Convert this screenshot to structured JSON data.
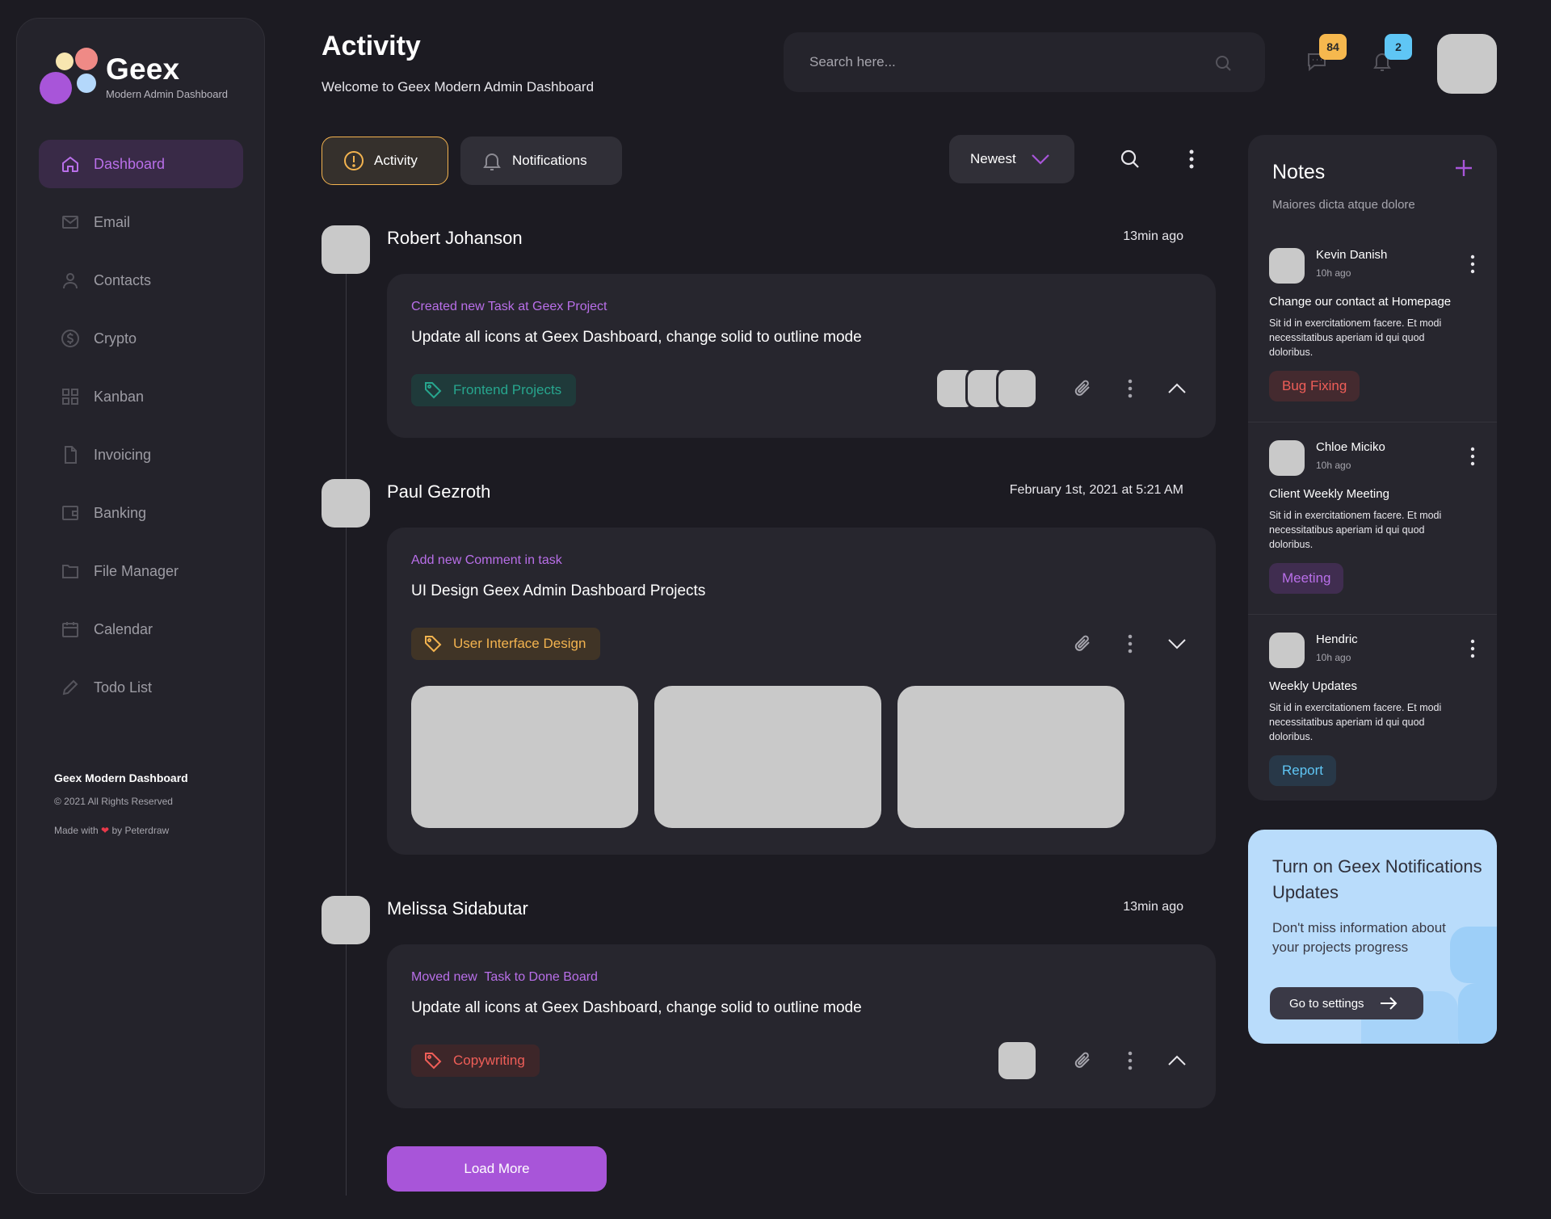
{
  "app": {
    "name": "Geex",
    "tagline": "Modern Admin Dashboard",
    "colors": {
      "accent": "#a855d9",
      "activity_border": "#f3b34f",
      "background": "#1c1b22",
      "panel": "#27262e"
    }
  },
  "header": {
    "title": "Activity",
    "subtitle": "Welcome to Geex Modern Admin Dashboard",
    "search_placeholder": "Search here...",
    "messages_badge": "84",
    "notifications_badge": "2"
  },
  "sidebar": {
    "items": [
      {
        "label": "Dashboard",
        "icon": "home-icon",
        "active": true
      },
      {
        "label": "Email",
        "icon": "mail-icon"
      },
      {
        "label": "Contacts",
        "icon": "user-icon"
      },
      {
        "label": "Crypto",
        "icon": "dollar-coin-icon"
      },
      {
        "label": "Kanban",
        "icon": "grid-icon"
      },
      {
        "label": "Invoicing",
        "icon": "document-icon"
      },
      {
        "label": "Banking",
        "icon": "wallet-icon"
      },
      {
        "label": "File Manager",
        "icon": "folder-icon"
      },
      {
        "label": "Calendar",
        "icon": "calendar-icon"
      },
      {
        "label": "Todo List",
        "icon": "pencil-icon"
      }
    ],
    "footer": {
      "title": "Geex Modern Dashboard",
      "copyright": "© 2021 All Rights Reserved",
      "made_with_prefix": "Made with",
      "made_with_suffix": "by Peterdraw"
    }
  },
  "toolbar": {
    "tab_activity": "Activity",
    "tab_notifications": "Notifications",
    "sort_value": "Newest"
  },
  "activities": [
    {
      "name": "Robert Johanson",
      "time": "13min ago",
      "kicker": "Created new Task at Geex Project",
      "title": "Update all icons at Geex Dashboard, change solid to outline mode",
      "tag": "Frontend Projects"
    },
    {
      "name": "Paul Gezroth",
      "time": "February 1st, 2021 at 5:21 AM",
      "kicker": "Add new Comment in task",
      "title": "UI Design Geex Admin Dashboard Projects",
      "tag": "User Interface Design"
    },
    {
      "name": "Melissa Sidabutar",
      "time": "13min ago",
      "kicker": "Moved new  Task to Done Board",
      "title": "Update all icons at Geex Dashboard, change solid to outline mode",
      "tag": "Copywriting"
    }
  ],
  "load_more": "Load More",
  "notes": {
    "title": "Notes",
    "subtitle": "Maiores dicta atque dolore",
    "items": [
      {
        "author": "Kevin Danish",
        "ago": "10h ago",
        "heading": "Change our contact at Homepage",
        "body": "Sit id in exercitationem facere. Et modi necessitatibus aperiam id qui quod doloribus.",
        "tag": "Bug Fixing"
      },
      {
        "author": "Chloe Miciko",
        "ago": "10h ago",
        "heading": "Client Weekly Meeting",
        "body": "Sit id in exercitationem facere. Et modi necessitatibus aperiam id qui quod doloribus.",
        "tag": "Meeting"
      },
      {
        "author": "Hendric",
        "ago": "10h ago",
        "heading": "Weekly Updates",
        "body": "Sit id in exercitationem facere. Et modi necessitatibus aperiam id qui quod doloribus.",
        "tag": "Report"
      }
    ]
  },
  "promo": {
    "title": "Turn on Geex Notifications Updates",
    "body": "Don't miss information about your projects progress",
    "button": "Go to settings"
  }
}
